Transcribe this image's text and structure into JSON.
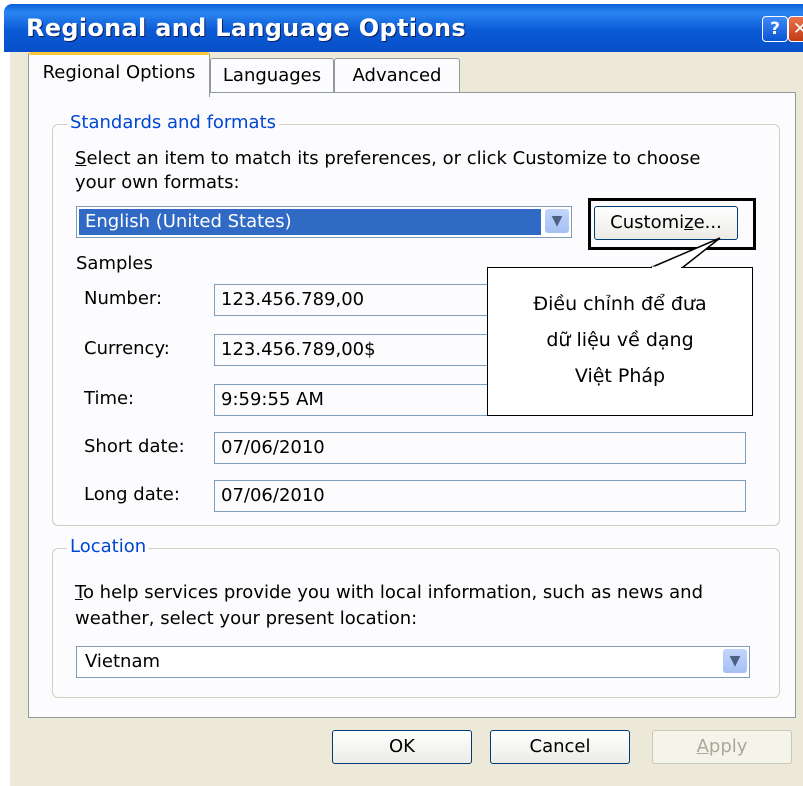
{
  "window": {
    "title": "Regional and Language Options",
    "help_icon": "help-icon",
    "close_icon": "close-icon"
  },
  "tabs": [
    {
      "label": "Regional Options",
      "active": true
    },
    {
      "label": "Languages",
      "active": false
    },
    {
      "label": "Advanced",
      "active": false
    }
  ],
  "standards": {
    "legend": "Standards and formats",
    "description_line1_mnemonic": "S",
    "description_line1_rest": "elect an item to match its preferences, or click Customize to choose",
    "description_line2": "your own formats:",
    "format_value": "English (United States)",
    "customize_label_pre": "Customi",
    "customize_label_mnemonic": "z",
    "customize_label_post": "e...",
    "samples_label": "Samples",
    "samples": [
      {
        "label": "Number:",
        "value": "123.456.789,00"
      },
      {
        "label": "Currency:",
        "value": "123.456.789,00$"
      },
      {
        "label": "Time:",
        "value": "9:59:55 AM"
      },
      {
        "label": "Short date:",
        "value": "07/06/2010"
      },
      {
        "label": "Long date:",
        "value": "07/06/2010"
      }
    ]
  },
  "callout": {
    "line1": "Điều chỉnh để đưa",
    "line2": "dữ liệu về dạng",
    "line3": "Việt Pháp"
  },
  "location": {
    "legend": "Location",
    "description_line1_mnemonic": "T",
    "description_line1_rest": "o help services provide you with local information, such as news and",
    "description_line2": "weather, select your present location:",
    "value": "Vietnam"
  },
  "buttons": {
    "ok": "OK",
    "cancel": "Cancel",
    "apply": "Apply",
    "apply_mnemonic": "A",
    "apply_rest": "pply"
  }
}
